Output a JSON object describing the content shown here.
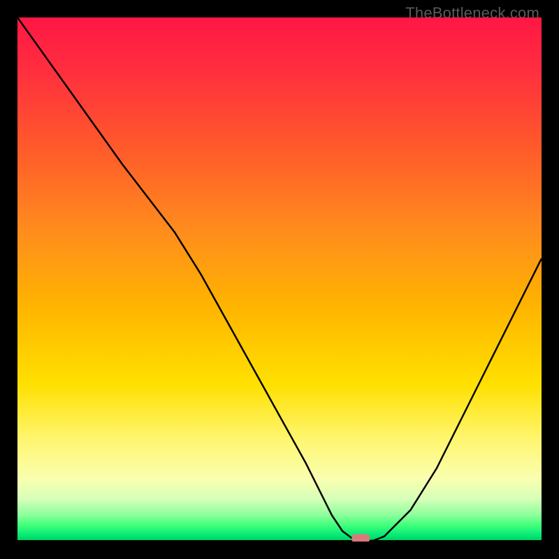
{
  "watermark": "TheBottleneck.com",
  "chart_data": {
    "type": "line",
    "title": "",
    "xlabel": "",
    "ylabel": "",
    "xlim": [
      0,
      100
    ],
    "ylim": [
      0,
      100
    ],
    "x": [
      0,
      5,
      10,
      15,
      20,
      25,
      30,
      35,
      40,
      45,
      50,
      55,
      58,
      60,
      62,
      64,
      66,
      68,
      70,
      75,
      80,
      85,
      90,
      95,
      100
    ],
    "values": [
      100,
      93,
      86,
      79,
      72,
      65.5,
      59,
      51,
      42,
      33,
      24,
      15,
      9,
      5,
      2,
      0.5,
      0,
      0.2,
      1,
      6,
      14,
      24,
      34,
      44,
      54
    ],
    "marker": {
      "x": 65.5,
      "y": 0.5,
      "color": "#d97a7a",
      "shape": "rounded-rect"
    },
    "gradient_stops": [
      {
        "offset": 0.0,
        "color": "#ff1744"
      },
      {
        "offset": 0.1,
        "color": "#ff2e3f"
      },
      {
        "offset": 0.25,
        "color": "#ff5a2a"
      },
      {
        "offset": 0.4,
        "color": "#ff8a1e"
      },
      {
        "offset": 0.55,
        "color": "#ffb400"
      },
      {
        "offset": 0.7,
        "color": "#ffe000"
      },
      {
        "offset": 0.8,
        "color": "#fff56b"
      },
      {
        "offset": 0.88,
        "color": "#faffb0"
      },
      {
        "offset": 0.92,
        "color": "#d4ffb8"
      },
      {
        "offset": 0.95,
        "color": "#8aff9a"
      },
      {
        "offset": 0.97,
        "color": "#3cff7a"
      },
      {
        "offset": 0.99,
        "color": "#00e676"
      },
      {
        "offset": 1.0,
        "color": "#00c853"
      }
    ]
  }
}
